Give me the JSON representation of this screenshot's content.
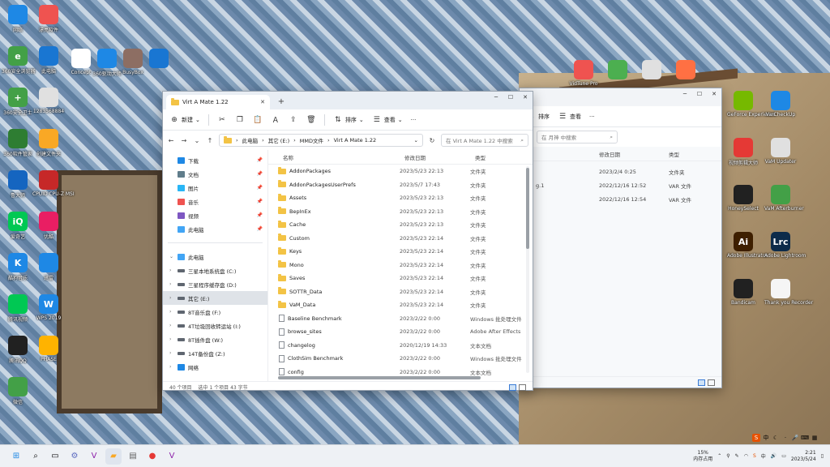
{
  "desktop": {
    "icons_left": [
      {
        "label": "网络",
        "color": "#1e88e5",
        "glyph": "network-icon"
      },
      {
        "label": "漂亮软件",
        "color": "#ef5350",
        "glyph": "folder-icon"
      },
      {
        "label": "360安全浏览器",
        "color": "#43a047",
        "glyph": "e"
      },
      {
        "label": "此电脑",
        "color": "#1976d2",
        "glyph": "pc-icon"
      },
      {
        "label": "360安全卫士",
        "color": "#43a047",
        "glyph": "+"
      },
      {
        "label": "1283568884",
        "color": "#e0e0e0",
        "glyph": "doc-icon"
      },
      {
        "label": "360软件管家",
        "color": "#2e7d32",
        "glyph": "app-icon"
      },
      {
        "label": "创建文件夹",
        "color": "#f9a825",
        "glyph": "folder-icon"
      },
      {
        "label": "鲁大师",
        "color": "#1565c0",
        "glyph": "face-icon"
      },
      {
        "label": "CPUID CPU-Z MSI",
        "color": "#c62828",
        "glyph": "chip-icon"
      },
      {
        "label": "爱奇艺",
        "color": "#00c853",
        "glyph": "iQ"
      },
      {
        "label": "优酷",
        "color": "#e91e63",
        "glyph": "play-icon"
      },
      {
        "label": "酷狗音乐",
        "color": "#1e88e5",
        "glyph": "K"
      },
      {
        "label": "迅雷",
        "color": "#1e88e5",
        "glyph": "bird-icon"
      },
      {
        "label": "腾讯视频",
        "color": "#00c853",
        "glyph": "play-icon"
      },
      {
        "label": "WPS 2019",
        "color": "#1e88e5",
        "glyph": "W"
      },
      {
        "label": "腾讯QQ",
        "color": "#212121",
        "glyph": "qq-icon"
      },
      {
        "label": "PHASE",
        "color": "#ffb300",
        "glyph": "chest-icon"
      },
      {
        "label": "微信",
        "color": "#43a047",
        "glyph": "wechat-icon"
      }
    ],
    "icons_top": [
      {
        "label": "Concept",
        "color": "#ffffff",
        "glyph": "gear-icon"
      },
      {
        "label": "360驱动大师",
        "color": "#1e88e5",
        "glyph": "gear-icon"
      },
      {
        "label": "BusyBox",
        "color": "#8d6e63",
        "glyph": "calendar-icon"
      },
      {
        "label": "",
        "color": "#1976d2",
        "glyph": "archive-icon"
      }
    ],
    "icons_right": [
      {
        "label": "GeForce Experience",
        "color": "#76b900",
        "glyph": "nvidia-icon"
      },
      {
        "label": "VarCheckUp",
        "color": "#1e88e5",
        "glyph": "check-icon"
      },
      {
        "label": "视频剪辑大师",
        "color": "#e53935",
        "glyph": "play-icon"
      },
      {
        "label": "VaM Updater",
        "color": "#e0e0e0",
        "glyph": "gear-icon"
      },
      {
        "label": "HoneySelect",
        "color": "#212121",
        "glyph": "camera-icon"
      },
      {
        "label": "VaM Afterburner",
        "color": "#43a047",
        "glyph": "ring-icon"
      },
      {
        "label": "Adobe Illustrator",
        "color": "#3e1f00",
        "glyph": "Ai"
      },
      {
        "label": "Adobe Lightroom",
        "color": "#0d2b4a",
        "glyph": "Lrc"
      },
      {
        "label": "Bandicam",
        "color": "#212121",
        "glyph": "record-icon"
      },
      {
        "label": "Thank you Recorder",
        "color": "#f5f5f5",
        "glyph": "doc-icon"
      }
    ],
    "shelf_icons": [
      {
        "label": "VidTune Pro",
        "color": "#ef5350"
      },
      {
        "label": "",
        "color": "#4caf50"
      },
      {
        "label": "",
        "color": "#e0e0e0"
      },
      {
        "label": "",
        "color": "#ff7043"
      }
    ]
  },
  "window_back": {
    "toolbar": {
      "sort": "排序",
      "view": "查看"
    },
    "search_placeholder": "在 月神 中搜索",
    "col_date": "修改日期",
    "col_type": "类型",
    "rows": [
      {
        "name": "",
        "date": "2023/2/4 0:25",
        "type": "文件夹"
      },
      {
        "name": "g.1",
        "date": "2022/12/16 12:52",
        "type": "VAR 文件"
      },
      {
        "name": "",
        "date": "2022/12/16 12:54",
        "type": "VAR 文件"
      }
    ]
  },
  "window_front": {
    "tab_title": "Virt A Mate 1.22",
    "toolbar": {
      "new": "新建",
      "sort": "排序",
      "view": "查看",
      "more": "···"
    },
    "breadcrumb": [
      "此电脑",
      "其它 (E:)",
      "MMD文件",
      "Virt A Mate 1.22"
    ],
    "search_placeholder": "在 Virt A Mate 1.22 中搜索",
    "nav_quick": [
      {
        "label": "下载",
        "color": "#1e88e5"
      },
      {
        "label": "文档",
        "color": "#607d8b"
      },
      {
        "label": "图片",
        "color": "#29b6f6"
      },
      {
        "label": "音乐",
        "color": "#ef5350"
      },
      {
        "label": "视频",
        "color": "#7e57c2"
      },
      {
        "label": "此电脑",
        "color": "#42a5f5"
      }
    ],
    "nav_pc_label": "此电脑",
    "nav_drives": [
      "三星本地系统盘 (C:)",
      "三星程序缓存盘 (D:)",
      "其它 (E:)",
      "8T音乐盘 (F:)",
      "4T垃圾回收转运站 (I:)",
      "8T插件盘 (W:)",
      "14T备份盘 (Z:)"
    ],
    "nav_network": "网络",
    "columns": {
      "name": "名称",
      "date": "修改日期",
      "type": "类型"
    },
    "files": [
      {
        "name": "AddonPackages",
        "date": "2023/5/23 22:13",
        "type": "文件夹",
        "kind": "folder"
      },
      {
        "name": "AddonPackagesUserPrefs",
        "date": "2023/5/7 17:43",
        "type": "文件夹",
        "kind": "folder"
      },
      {
        "name": "Assets",
        "date": "2023/5/23 22:13",
        "type": "文件夹",
        "kind": "folder"
      },
      {
        "name": "BepInEx",
        "date": "2023/5/23 22:13",
        "type": "文件夹",
        "kind": "folder"
      },
      {
        "name": "Cache",
        "date": "2023/5/23 22:13",
        "type": "文件夹",
        "kind": "folder"
      },
      {
        "name": "Custom",
        "date": "2023/5/23 22:14",
        "type": "文件夹",
        "kind": "folder"
      },
      {
        "name": "Keys",
        "date": "2023/5/23 22:14",
        "type": "文件夹",
        "kind": "folder"
      },
      {
        "name": "Mono",
        "date": "2023/5/23 22:14",
        "type": "文件夹",
        "kind": "folder"
      },
      {
        "name": "Saves",
        "date": "2023/5/23 22:14",
        "type": "文件夹",
        "kind": "folder"
      },
      {
        "name": "SOTTR_Data",
        "date": "2023/5/23 22:14",
        "type": "文件夹",
        "kind": "folder"
      },
      {
        "name": "VaM_Data",
        "date": "2023/5/23 22:14",
        "type": "文件夹",
        "kind": "folder"
      },
      {
        "name": "Baseline Benchmark",
        "date": "2023/2/22 0:00",
        "type": "Windows 批处理文件",
        "kind": "file"
      },
      {
        "name": "browse_sites",
        "date": "2023/2/22 0:00",
        "type": "Adobe After Effects",
        "kind": "file"
      },
      {
        "name": "changelog",
        "date": "2020/12/19 14:33",
        "type": "文本文档",
        "kind": "file"
      },
      {
        "name": "ClothSim Benchmark",
        "date": "2023/2/22 0:00",
        "type": "Windows 批处理文件",
        "kind": "file"
      },
      {
        "name": "config",
        "date": "2023/2/22 0:00",
        "type": "文本文档",
        "kind": "file"
      }
    ],
    "status_count": "40 个项目",
    "status_selected": "选中 1 个项目  43 字节"
  },
  "taskbar": {
    "cpu_pct": "15%",
    "cpu_label": "内存占用",
    "time": "2:21",
    "date": "2023/5/24",
    "ime_lang": "中"
  }
}
